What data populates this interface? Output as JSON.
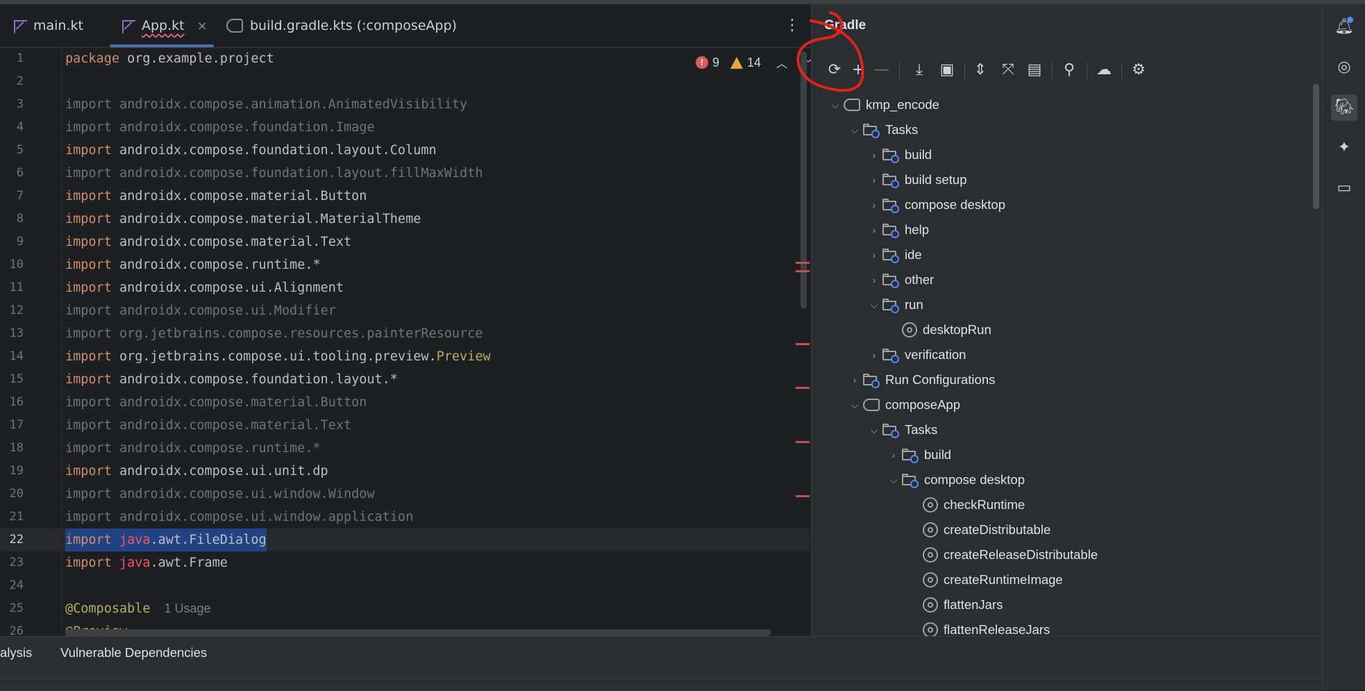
{
  "editor": {
    "tabs": [
      {
        "label": "main.kt"
      },
      {
        "label": "App.kt",
        "close": "×"
      },
      {
        "label": "build.gradle.kts (:composeApp)"
      }
    ],
    "more": "⋮",
    "errors": "9",
    "warnings": "14",
    "lines": [
      {
        "n": "1"
      },
      {
        "n": "2"
      },
      {
        "n": "3"
      },
      {
        "n": "4"
      },
      {
        "n": "5"
      },
      {
        "n": "6"
      },
      {
        "n": "7"
      },
      {
        "n": "8"
      },
      {
        "n": "9"
      },
      {
        "n": "10"
      },
      {
        "n": "11"
      },
      {
        "n": "12"
      },
      {
        "n": "13"
      },
      {
        "n": "14"
      },
      {
        "n": "15"
      },
      {
        "n": "16"
      },
      {
        "n": "17"
      },
      {
        "n": "18"
      },
      {
        "n": "19"
      },
      {
        "n": "20"
      },
      {
        "n": "21"
      },
      {
        "n": "22"
      },
      {
        "n": "23"
      },
      {
        "n": "24"
      },
      {
        "n": "25"
      },
      {
        "n": "26"
      }
    ],
    "code": {
      "kw_package": "package",
      "kw_import": "import",
      "l1": "org.example.project",
      "l3": "androidx.compose.animation.AnimatedVisibility",
      "l4": "androidx.compose.foundation.Image",
      "l5": "androidx.compose.foundation.layout.Column",
      "l6": "androidx.compose.foundation.layout.fillMaxWidth",
      "l7": "androidx.compose.material.Button",
      "l8": "androidx.compose.material.MaterialTheme",
      "l9": "androidx.compose.material.Text",
      "l10": "androidx.compose.runtime.*",
      "l11": "androidx.compose.ui.Alignment",
      "l12": "androidx.compose.ui.Modifier",
      "l13": "org.jetbrains.compose.resources.painterResource",
      "l14a": "org.jetbrains.compose.ui.tooling.preview.",
      "l14b": "Preview",
      "l15": "androidx.compose.foundation.layout.*",
      "l16": "androidx.compose.material.Button",
      "l17": "androidx.compose.material.Text",
      "l18": "androidx.compose.runtime.*",
      "l19": "androidx.compose.ui.unit.dp",
      "l20": "androidx.compose.ui.window.Window",
      "l21": "androidx.compose.ui.window.application",
      "java": "java",
      "l22b": ".awt.FileDialog",
      "l23b": ".awt.Frame",
      "l25": "@Composable",
      "l25usage": "1 Usage",
      "l26": "@Preview"
    }
  },
  "gradle": {
    "title": "Gradle",
    "tree": [
      {
        "label": "kmp_encode"
      },
      {
        "label": "Tasks"
      },
      {
        "label": "build"
      },
      {
        "label": "build setup"
      },
      {
        "label": "compose desktop"
      },
      {
        "label": "help"
      },
      {
        "label": "ide"
      },
      {
        "label": "other"
      },
      {
        "label": "run"
      },
      {
        "label": "desktopRun"
      },
      {
        "label": "verification"
      },
      {
        "label": "Run Configurations"
      },
      {
        "label": "composeApp"
      },
      {
        "label": "Tasks"
      },
      {
        "label": "build"
      },
      {
        "label": "compose desktop"
      },
      {
        "label": "checkRuntime"
      },
      {
        "label": "createDistributable"
      },
      {
        "label": "createReleaseDistributable"
      },
      {
        "label": "createRuntimeImage"
      },
      {
        "label": "flattenJars"
      },
      {
        "label": "flattenReleaseJars"
      }
    ]
  },
  "bottom": {
    "tabs": [
      {
        "label": "alysis"
      },
      {
        "label": "Vulnerable Dependencies"
      }
    ]
  },
  "colors": {
    "annotation": "#e0241b",
    "accent": "#548af7",
    "error": "#db5c5c",
    "warning": "#e0a93e"
  }
}
